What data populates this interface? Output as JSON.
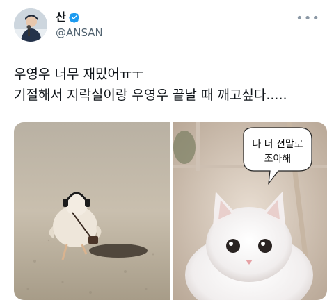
{
  "tweet": {
    "display_name": "산",
    "handle": "@ANSAN",
    "more_icon": "more-horizontal-icon",
    "verified_icon": "verified-badge-icon",
    "text_lines": [
      "우영우 너무 재밌어ㅠㅜ",
      "기절해서 지락실이랑 우영우 끝날 때 깨고싶다....."
    ]
  },
  "media": {
    "image1": {
      "subject": "chick-with-headphones"
    },
    "image2": {
      "subject": "white-cat",
      "speech_bubble": [
        "나 너 젼말로",
        "조아해"
      ]
    }
  },
  "colors": {
    "verified": "#1d9bf0",
    "text": "#0f1419",
    "secondary": "#536471"
  }
}
